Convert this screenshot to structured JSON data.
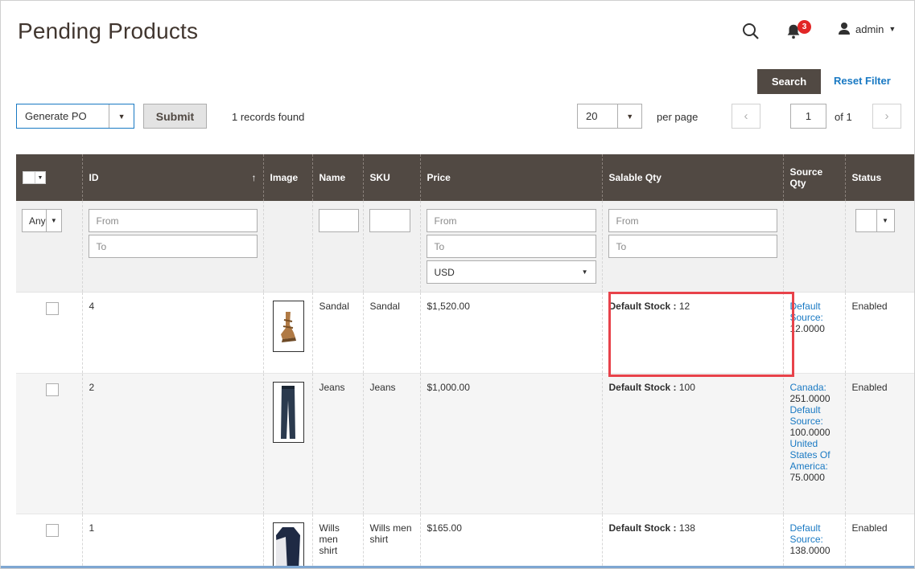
{
  "header": {
    "title": "Pending Products",
    "notification_count": "3",
    "user_label": "admin"
  },
  "actions": {
    "search_label": "Search",
    "reset_label": "Reset Filter"
  },
  "toolbar": {
    "mass_action": "Generate PO",
    "submit_label": "Submit",
    "records_found": "1 records found",
    "per_page_value": "20",
    "per_page_label": "per page",
    "current_page": "1",
    "page_of": "of 1"
  },
  "columns": {
    "id": "ID",
    "image": "Image",
    "name": "Name",
    "sku": "SKU",
    "price": "Price",
    "salable_qty": "Salable Qty",
    "source_qty": "Source Qty",
    "status": "Status"
  },
  "filters": {
    "any": "Any",
    "id_from": "From",
    "id_to": "To",
    "price_from": "From",
    "price_to": "To",
    "currency": "USD",
    "qty_from": "From",
    "qty_to": "To"
  },
  "rows": [
    {
      "id": "4",
      "name": "Sandal",
      "sku": "Sandal",
      "price": "$1,520.00",
      "stock_label": "Default Stock :",
      "stock_value": "12",
      "sources": [
        {
          "name": "Default Source:",
          "qty": "12.0000"
        }
      ],
      "status": "Enabled",
      "image_icon": "sandal-thumbnail"
    },
    {
      "id": "2",
      "name": "Jeans",
      "sku": "Jeans",
      "price": "$1,000.00",
      "stock_label": "Default Stock :",
      "stock_value": "100",
      "sources": [
        {
          "name": "Canada:",
          "qty": "251.0000"
        },
        {
          "name": "Default Source:",
          "qty": "100.0000"
        },
        {
          "name": "United States Of America:",
          "qty": "75.0000"
        }
      ],
      "status": "Enabled",
      "image_icon": "jeans-thumbnail"
    },
    {
      "id": "1",
      "name": "Wills men shirt",
      "sku": "Wills men shirt",
      "price": "$165.00",
      "stock_label": "Default Stock :",
      "stock_value": "138",
      "sources": [
        {
          "name": "Default Source:",
          "qty": "138.0000"
        }
      ],
      "status": "Enabled",
      "image_icon": "shirt-thumbnail"
    }
  ],
  "colors": {
    "header_bg": "#514943",
    "link": "#1979c3",
    "highlight": "#e8424a",
    "badge": "#e22626"
  }
}
